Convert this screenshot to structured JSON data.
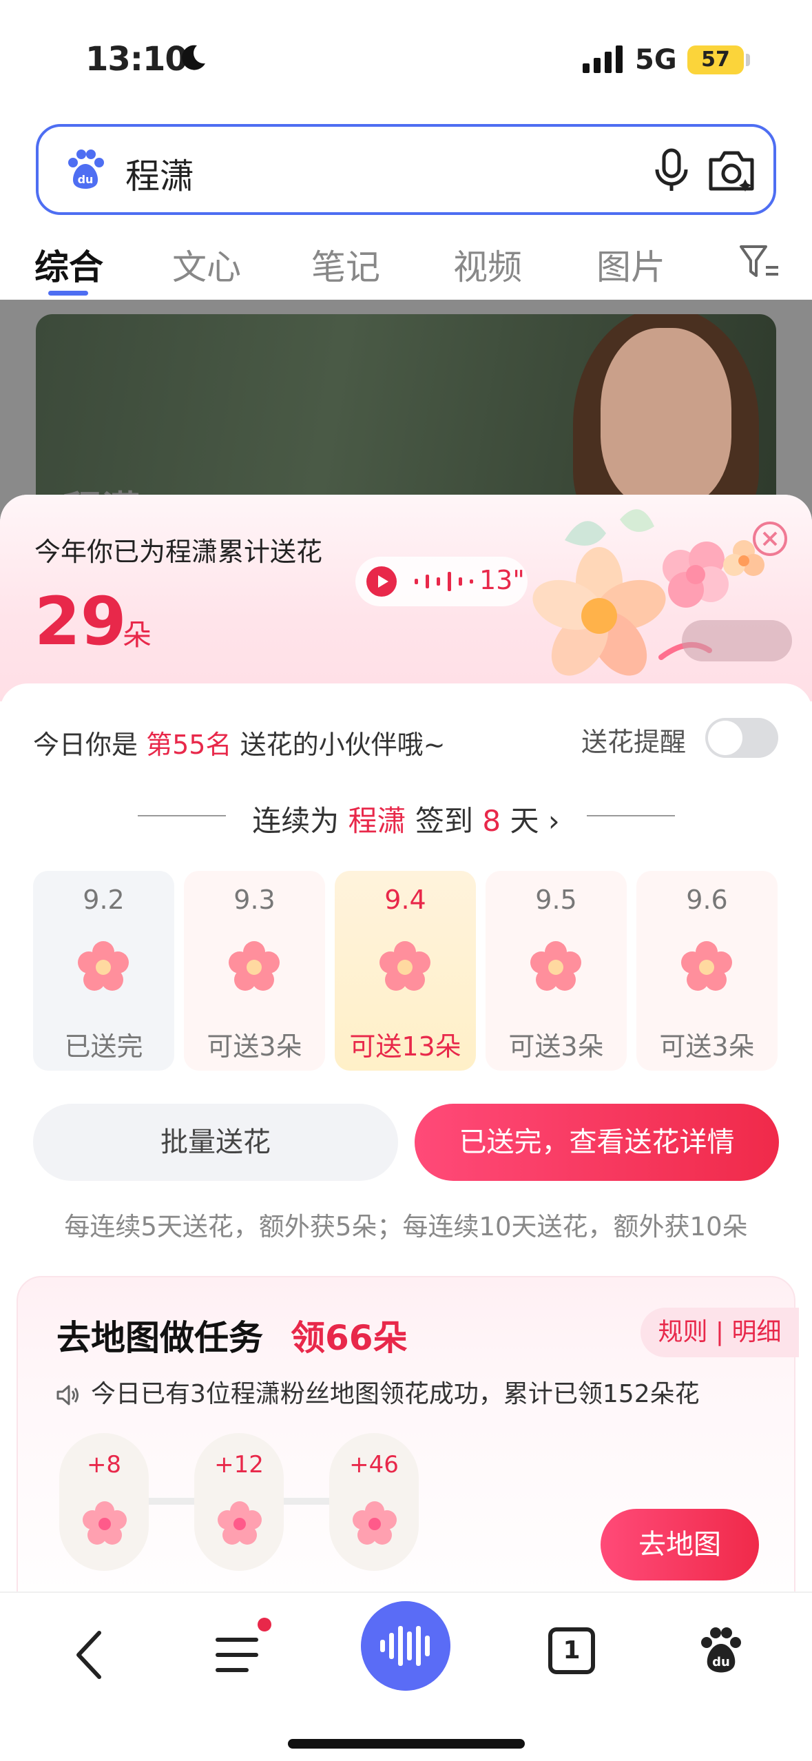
{
  "status_bar": {
    "time": "13:10",
    "network": "5G",
    "battery": "57"
  },
  "search": {
    "query": "程潇"
  },
  "tabs": [
    {
      "label": "综合"
    },
    {
      "label": "文心"
    },
    {
      "label": "笔记"
    },
    {
      "label": "视频"
    },
    {
      "label": "图片"
    }
  ],
  "background_card": {
    "title": "程潇"
  },
  "flower_panel": {
    "total_label": "今年你已为程潇累计送花",
    "total_count": "29",
    "total_unit": "朵",
    "voice_duration": "13\"",
    "rank_prefix": "今日你是",
    "rank_value": "第55名",
    "rank_suffix": "送花的小伙伴哦~",
    "reminder_label": "送花提醒",
    "reminder_on": false,
    "streak_prefix": "连续为",
    "streak_name": "程潇",
    "streak_mid": "签到",
    "streak_days": "8",
    "streak_suffix": "天",
    "days": [
      {
        "date": "9.2",
        "status": "已送完"
      },
      {
        "date": "9.3",
        "status": "可送3朵"
      },
      {
        "date": "9.4",
        "status": "可送13朵"
      },
      {
        "date": "9.5",
        "status": "可送3朵"
      },
      {
        "date": "9.6",
        "status": "可送3朵"
      }
    ],
    "batch_button": "批量送花",
    "detail_button": "已送完，查看送花详情",
    "bonus_tip": "每连续5天送花，额外获5朵；每连续10天送花，额外获10朵"
  },
  "map_task": {
    "title": "去地图做任务",
    "reward": "领66朵",
    "rules_link": "规则 | 明细",
    "notice": "今日已有3位程潇粉丝地图领花成功，累计已领152朵花",
    "steps": [
      {
        "amount": "+8"
      },
      {
        "amount": "+12"
      },
      {
        "amount": "+46"
      }
    ],
    "go_button": "去地图"
  },
  "bottom_nav": {
    "tab_count": "1"
  },
  "colors": {
    "accent": "#e8284a",
    "brand_blue": "#4e6ef2"
  }
}
